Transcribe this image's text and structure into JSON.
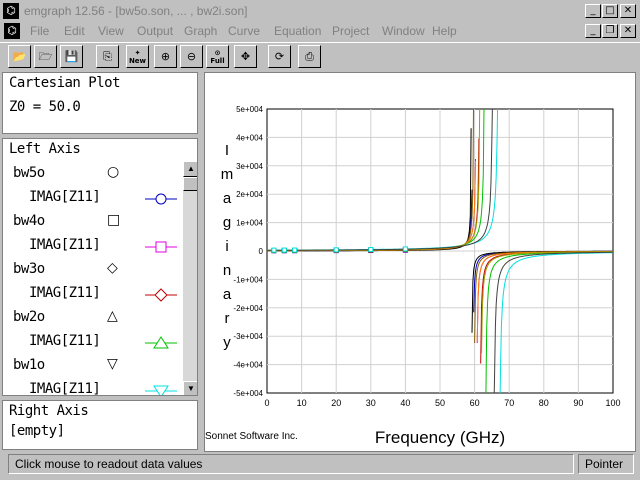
{
  "window": {
    "title": "emgraph 12.56 - [bw5o.son, ... , bw2i.son]",
    "min": "_",
    "restore": "❐",
    "close": "✕"
  },
  "menu": {
    "items": [
      "File",
      "Edit",
      "View",
      "Output",
      "Graph",
      "Curve",
      "Equation",
      "Project",
      "Window",
      "Help"
    ]
  },
  "toolbar": {
    "new_label": "New",
    "full_label": "Full"
  },
  "plot_info": {
    "type": "Cartesian Plot",
    "z0": "Z0 = 50.0"
  },
  "left_axis": {
    "heading": "Left Axis",
    "entries": [
      {
        "name": "bw5o",
        "param": "IMAG[Z11]",
        "marker": "circle",
        "color": "#0000c0"
      },
      {
        "name": "bw4o",
        "param": "IMAG[Z11]",
        "marker": "square",
        "color": "#e000e0"
      },
      {
        "name": "bw3o",
        "param": "IMAG[Z11]",
        "marker": "diamond",
        "color": "#c00000"
      },
      {
        "name": "bw2o",
        "param": "IMAG[Z11]",
        "marker": "triangle",
        "color": "#00c000"
      },
      {
        "name": "bw1o",
        "param": "IMAG[Z11]",
        "marker": "triangle-down",
        "color": "#00e0e0"
      }
    ]
  },
  "right_axis": {
    "heading": "Right Axis",
    "value": "[empty]"
  },
  "graph": {
    "credit": "Sonnet Software Inc."
  },
  "chart_data": {
    "type": "line",
    "xlabel": "Frequency (GHz)",
    "ylabel": "Imaginary",
    "xlim": [
      0,
      100
    ],
    "ylim": [
      -50000,
      50000
    ],
    "x_ticks": [
      "0",
      "10",
      "20",
      "30",
      "40",
      "50",
      "60",
      "70",
      "80",
      "90",
      "100"
    ],
    "y_ticks": [
      "5e+004",
      "4e+004",
      "3e+004",
      "2e+004",
      "1e+004",
      "0",
      "-1e+004",
      "-2e+004",
      "-3e+004",
      "-4e+004",
      "-5e+004"
    ],
    "grid": true,
    "series": [
      {
        "name": "bw5o",
        "color": "#0000c0",
        "resonance": 59.5,
        "spread": 0.6
      },
      {
        "name": "bw4o",
        "color": "#e000e0",
        "resonance": 60.5,
        "spread": 0.9
      },
      {
        "name": "bw3o",
        "color": "#c00000",
        "resonance": 61.5,
        "spread": 1.1
      },
      {
        "name": "bw2o",
        "color": "#00c000",
        "resonance": 63.0,
        "spread": 1.5
      },
      {
        "name": "bw1o",
        "color": "#00e0e0",
        "resonance": 67.0,
        "spread": 2.2
      }
    ]
  },
  "status": {
    "message": "Click mouse to readout data values",
    "mode": "Pointer"
  }
}
